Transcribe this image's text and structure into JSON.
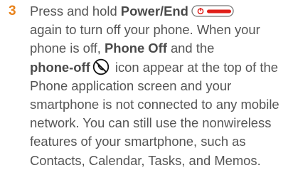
{
  "step": {
    "number": "3",
    "line1_prefix": "Press and hold ",
    "power_key_label": "Power/End",
    "line1_rest": "again to turn off your phone. When your phone is off, ",
    "phone_off_label": "Phone Off",
    "and_the": " and the",
    "phone_off_icon_label": "phone-off",
    "rest": " icon appear at the top of the Phone application screen and your smartphone is not connected to any mobile network. You can still use the nonwireless features of your smartphone, such as Contacts, Calendar, Tasks, and Memos.",
    "icons": {
      "power_key": "power-end-key-icon",
      "phone_off": "phone-off-icon"
    },
    "colors": {
      "step_number": "#e8821a",
      "power_key_accent": "#e0201a",
      "body_text": "#555555"
    }
  }
}
